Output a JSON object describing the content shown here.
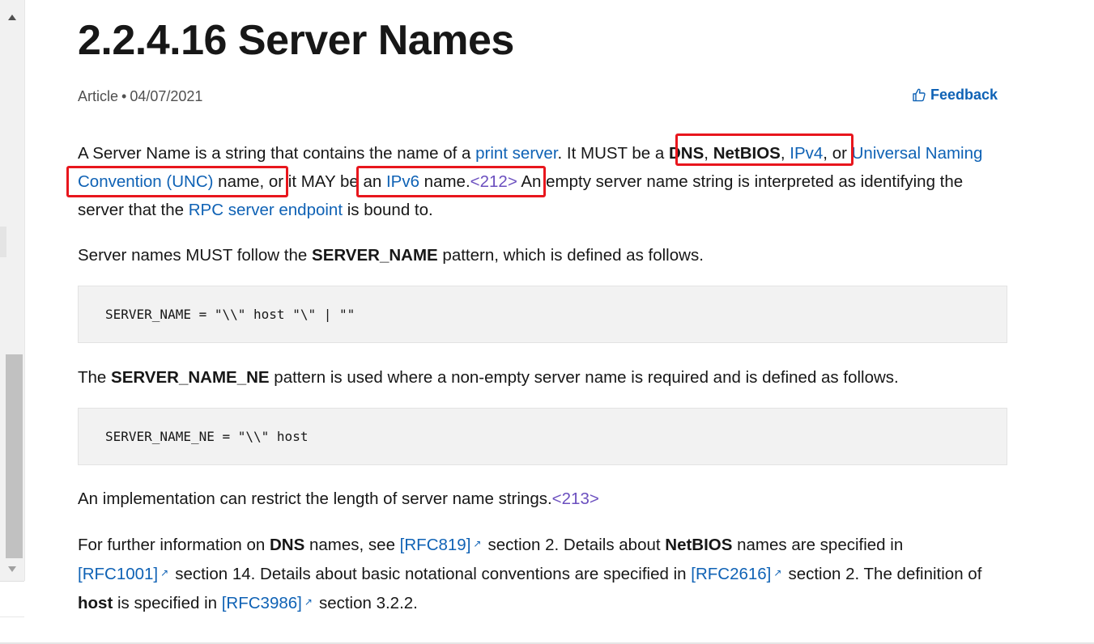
{
  "title": "2.2.4.16 Server Names",
  "meta": {
    "type": "Article",
    "separator": "•",
    "date": "04/07/2021"
  },
  "feedback": {
    "label": "Feedback",
    "icon": "thumbs-up-icon"
  },
  "para1": {
    "t1": "A Server Name is a string that contains the name of a ",
    "link_print_server": "print server",
    "t2": ". It MUST be a ",
    "b_dns": "DNS",
    "c1": ", ",
    "b_netbios": "NetBIOS",
    "c2": ", ",
    "link_ipv4": "IPv4",
    "t3": ", or ",
    "link_unc": "Universal Naming Convention (UNC)",
    "t4": " name, or it MAY be an ",
    "link_ipv6": "IPv6",
    "t5": " name.",
    "ref212": "<212>",
    "t6": " An empty server name string is interpreted as identifying the server that the ",
    "link_rpc": "RPC server endpoint",
    "t7": " is bound to."
  },
  "para2": {
    "t1": "Server names MUST follow the ",
    "b": "SERVER_NAME",
    "t2": " pattern, which is defined as follows."
  },
  "code1": "SERVER_NAME = \"\\\\\" host \"\\\" | \"\"",
  "para3": {
    "t1": "The ",
    "b": "SERVER_NAME_NE",
    "t2": " pattern is used where a non-empty server name is required and is defined as follows."
  },
  "code2": "SERVER_NAME_NE = \"\\\\\" host",
  "para4": {
    "t1": "An implementation can restrict the length of server name strings.",
    "ref213": "<213>"
  },
  "para5": {
    "t1": "For further information on ",
    "b_dns": "DNS",
    "t2": " names, see ",
    "rfc819": "[RFC819]",
    "t3": "section 2. Details about ",
    "b_netbios": "NetBIOS",
    "t4": " names are specified in ",
    "rfc1001": "[RFC1001]",
    "t5": "section 14. Details about basic notational conventions are specified in ",
    "rfc2616": "[RFC2616]",
    "t6": "section 2. The definition of ",
    "b_host": "host",
    "t7": " is specified in ",
    "rfc3986": "[RFC3986]",
    "t8": "section 3.2.2."
  },
  "ext_icon": "↗",
  "colors": {
    "link": "#0f62b5",
    "highlight": "#e8161d",
    "code_bg": "#f2f2f2"
  }
}
